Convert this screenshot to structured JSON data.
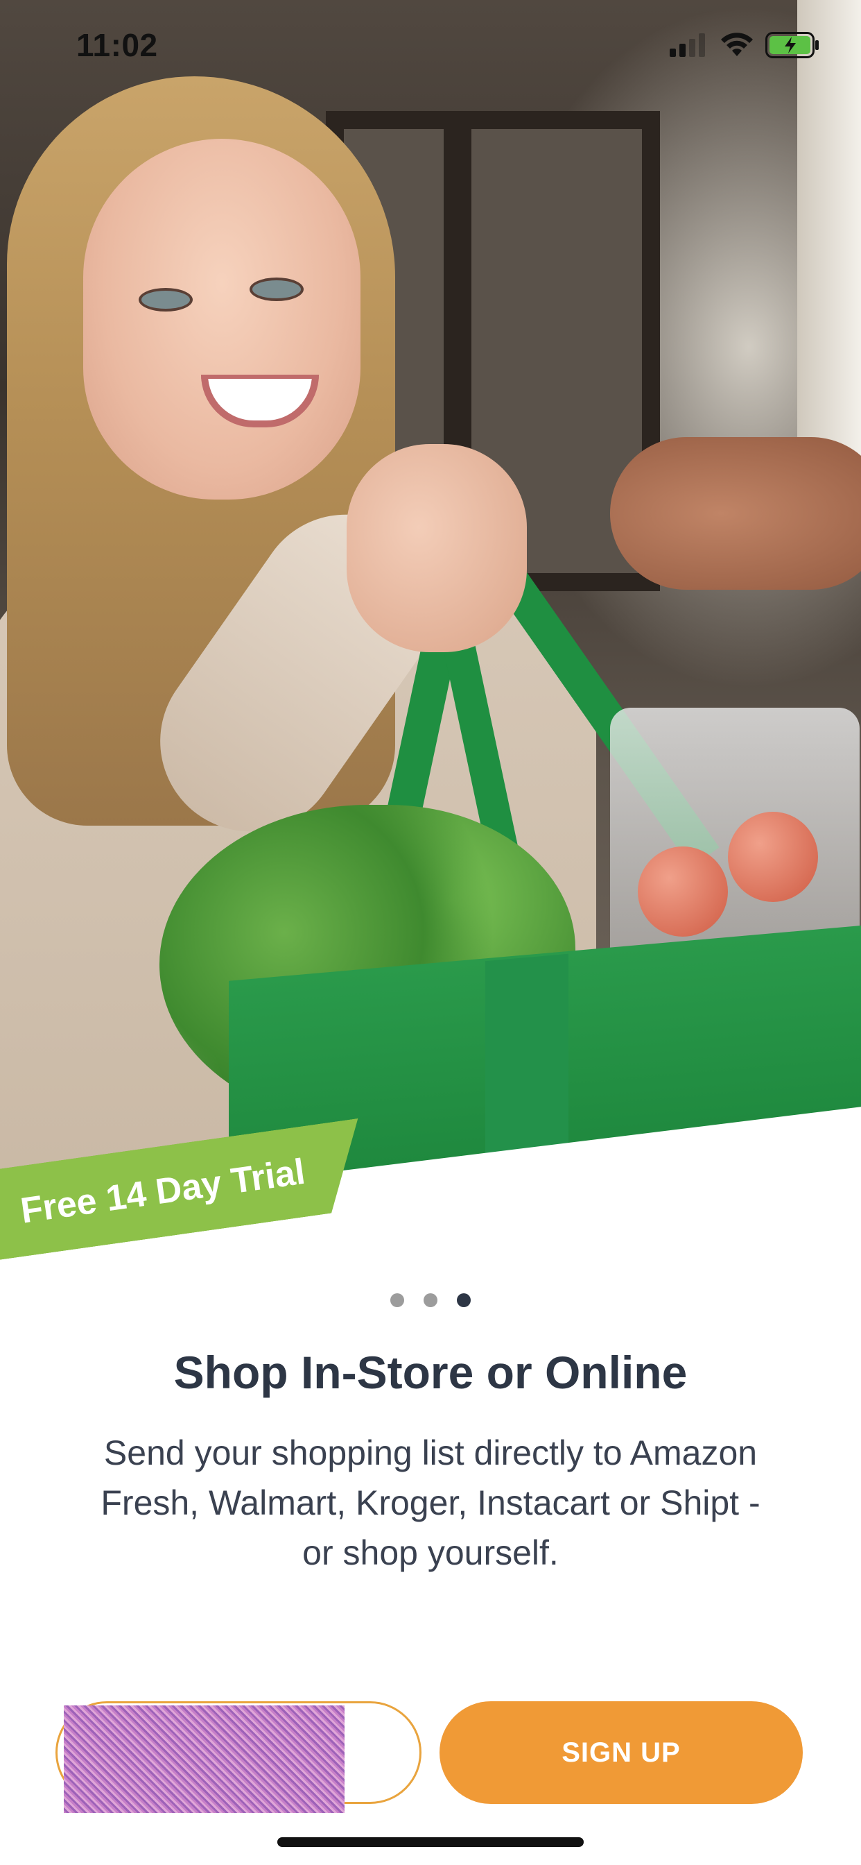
{
  "status_bar": {
    "time": "11:02",
    "icons": [
      "cellular-signal-icon",
      "wifi-icon",
      "battery-charging-icon"
    ]
  },
  "hero": {
    "image": "woman-handing-green-grocery-bag-photo",
    "badge_text": "Free 14 Day Trial"
  },
  "pager": {
    "count": 3,
    "active_index": 2
  },
  "content": {
    "title": "Shop In-Store or Online",
    "body": "Send your shopping list directly to Amazon Fresh, Walmart, Kroger, Instacart or Shipt - or shop yourself."
  },
  "buttons": {
    "signup_label": "SIGN UP"
  },
  "colors": {
    "accent_orange": "#f09a36",
    "badge_green": "#8dc149",
    "text_dark": "#2d3645"
  }
}
